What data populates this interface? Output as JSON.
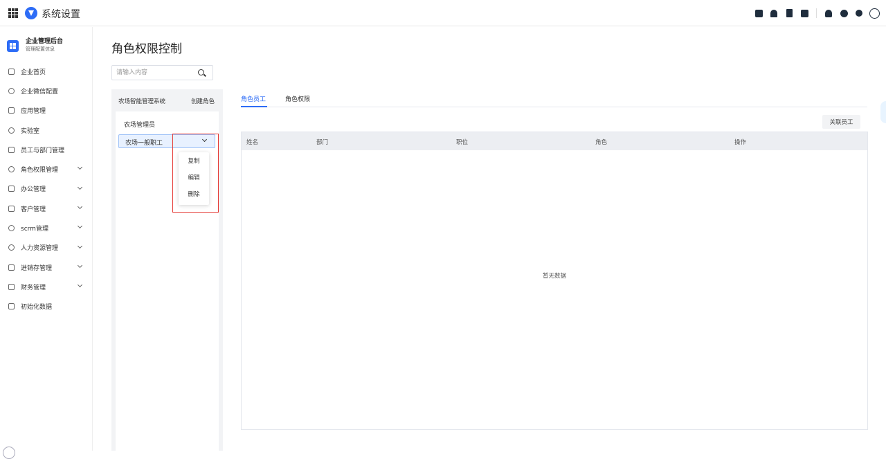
{
  "header": {
    "title": "系统设置"
  },
  "sidebar": {
    "brand_name": "企业管理后台",
    "brand_sub": "管理配置信息",
    "items": [
      {
        "label": "企业首页",
        "icon": "home-icon",
        "expandable": false
      },
      {
        "label": "企业微信配置",
        "icon": "wechat-icon",
        "expandable": false
      },
      {
        "label": "应用管理",
        "icon": "apps-icon",
        "expandable": false
      },
      {
        "label": "实验室",
        "icon": "lab-icon",
        "expandable": false
      },
      {
        "label": "员工与部门管理",
        "icon": "team-icon",
        "expandable": false
      },
      {
        "label": "角色权限管理",
        "icon": "role-icon",
        "expandable": true
      },
      {
        "label": "办公管理",
        "icon": "office-icon",
        "expandable": true
      },
      {
        "label": "客户管理",
        "icon": "customer-icon",
        "expandable": true
      },
      {
        "label": "scrm管理",
        "icon": "scrm-icon",
        "expandable": true
      },
      {
        "label": "人力资源管理",
        "icon": "hr-icon",
        "expandable": true
      },
      {
        "label": "进销存管理",
        "icon": "inventory-icon",
        "expandable": true
      },
      {
        "label": "财务管理",
        "icon": "finance-icon",
        "expandable": true
      },
      {
        "label": "初始化数据",
        "icon": "init-icon",
        "expandable": false
      }
    ]
  },
  "main": {
    "title": "角色权限控制",
    "search_placeholder": "请输入内容",
    "role_panel": {
      "system_name": "农场智能管理系统",
      "create_label": "创建角色",
      "roles": [
        "农场管理员",
        "农场一般职工"
      ],
      "dropdown": [
        "复制",
        "编辑",
        "删除"
      ]
    },
    "tabs": [
      "角色员工",
      "角色权限"
    ],
    "assoc_button": "关联员工",
    "table": {
      "columns": [
        "姓名",
        "部门",
        "职位",
        "角色",
        "操作"
      ],
      "empty_text": "暂无数据"
    }
  },
  "colors": {
    "accent": "#2d6cf6",
    "highlight_box": "#e53935"
  }
}
